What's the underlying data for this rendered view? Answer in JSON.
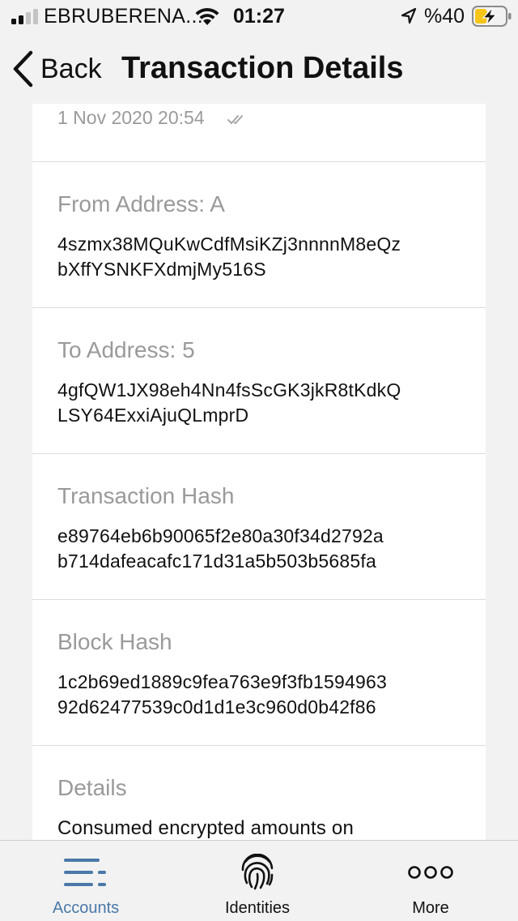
{
  "status_bar": {
    "carrier": "EBRUBERENA...",
    "time": "01:27",
    "battery_percent": "%40",
    "signal_icon": "cellular-signal-icon",
    "wifi_icon": "wifi-icon",
    "location_icon": "location-arrow-icon",
    "battery_icon": "battery-charging-icon",
    "battery_level": 0.4,
    "battery_color": "#f5c518"
  },
  "nav": {
    "back_label": "Back",
    "title": "Transaction Details"
  },
  "transaction": {
    "timestamp": "1 Nov 2020 20:54",
    "sections": [
      {
        "label": "From Address: A",
        "value_lines": [
          "4szmx38MQuKwCdfMsiKZj3nnnnM8eQz",
          "bXffYSNKFXdmjMy516S"
        ]
      },
      {
        "label": "To Address: 5",
        "value_lines": [
          "4gfQW1JX98eh4Nn4fsScGK3jkR8tKdkQ",
          "LSY64ExxiAjuQLmprD"
        ]
      },
      {
        "label": "Transaction Hash",
        "value_lines": [
          "e89764eb6b90065f2e80a30f34d2792a",
          "b714dafeacafc171d31a5b503b5685fa"
        ]
      },
      {
        "label": "Block Hash",
        "value_lines": [
          "1c2b69ed1889c9fea763e9f3fb1594963",
          "92d62477539c0d1d1e3c960d0b42f86"
        ]
      },
      {
        "label": "Details",
        "value_lines": [
          "Consumed encrypted amounts on"
        ]
      }
    ]
  },
  "tab_bar": {
    "accent_color": "#4a78a8",
    "tabs": [
      {
        "label": "Accounts",
        "icon": "accounts-list-icon",
        "active": true
      },
      {
        "label": "Identities",
        "icon": "fingerprint-icon",
        "active": false
      },
      {
        "label": "More",
        "icon": "more-dots-icon",
        "active": false
      }
    ]
  }
}
